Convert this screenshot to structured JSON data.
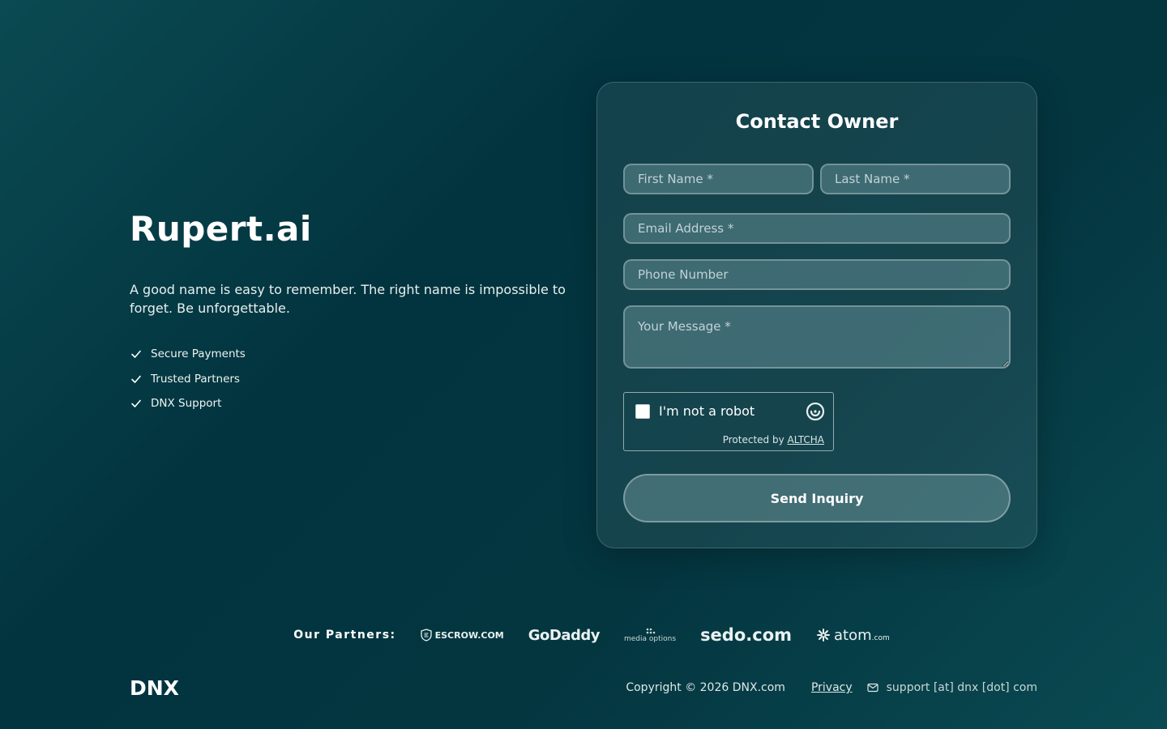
{
  "hero": {
    "title": "Rupert.ai",
    "tagline": "A good name is easy to remember. The right name is impossible to forget. Be unforgettable.",
    "features": [
      "Secure Payments",
      "Trusted Partners",
      "DNX Support"
    ]
  },
  "form": {
    "title": "Contact Owner",
    "first_name_placeholder": "First Name *",
    "last_name_placeholder": "Last Name *",
    "email_placeholder": "Email Address *",
    "phone_placeholder": "Phone Number",
    "message_placeholder": "Your Message *",
    "captcha_label": "I'm not a robot",
    "captcha_protected_prefix": "Protected by",
    "captcha_provider": "ALTCHA",
    "submit_label": "Send Inquiry"
  },
  "partners": {
    "label": "Our Partners:",
    "escrow": "ESCROW.COM",
    "godaddy": "GoDaddy",
    "media_top": "media",
    "media_bottom": "options",
    "sedo": "sedo.com",
    "atom": "atom",
    "atom_suffix": ".com"
  },
  "footer": {
    "logo": "DNX",
    "copyright": "Copyright © 2026 DNX.com",
    "privacy": "Privacy",
    "support": "support [at] dnx [dot] com"
  },
  "colors": {
    "background_dark": "#02343f",
    "background_teal": "#0b4a52"
  }
}
